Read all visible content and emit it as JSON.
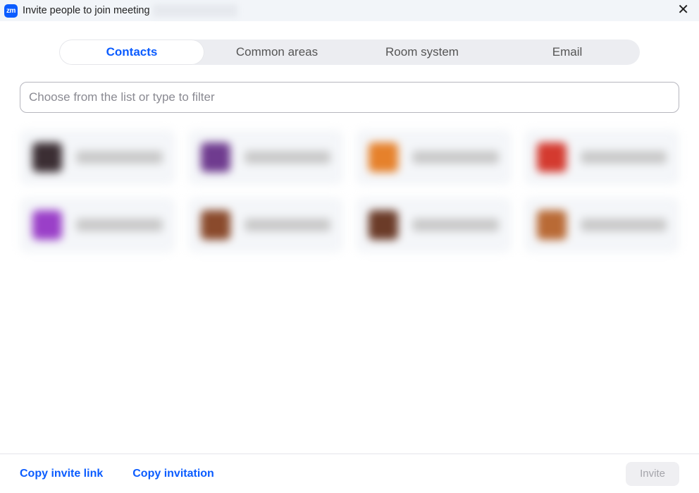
{
  "titlebar": {
    "app_icon_text": "zm",
    "title": "Invite people to join meeting"
  },
  "tabs": [
    {
      "label": "Contacts",
      "active": true
    },
    {
      "label": "Common areas",
      "active": false
    },
    {
      "label": "Room system",
      "active": false
    },
    {
      "label": "Email",
      "active": false
    }
  ],
  "search": {
    "placeholder": "Choose from the list or type to filter",
    "value": ""
  },
  "contacts": [
    {
      "avatar_class": "av-c0"
    },
    {
      "avatar_class": "av-c1"
    },
    {
      "avatar_class": "av-c2"
    },
    {
      "avatar_class": "av-c3"
    },
    {
      "avatar_class": "av-c4"
    },
    {
      "avatar_class": "av-c5"
    },
    {
      "avatar_class": "av-c6"
    },
    {
      "avatar_class": "av-c7"
    }
  ],
  "footer": {
    "copy_link": "Copy invite link",
    "copy_invitation": "Copy invitation",
    "invite": "Invite"
  }
}
